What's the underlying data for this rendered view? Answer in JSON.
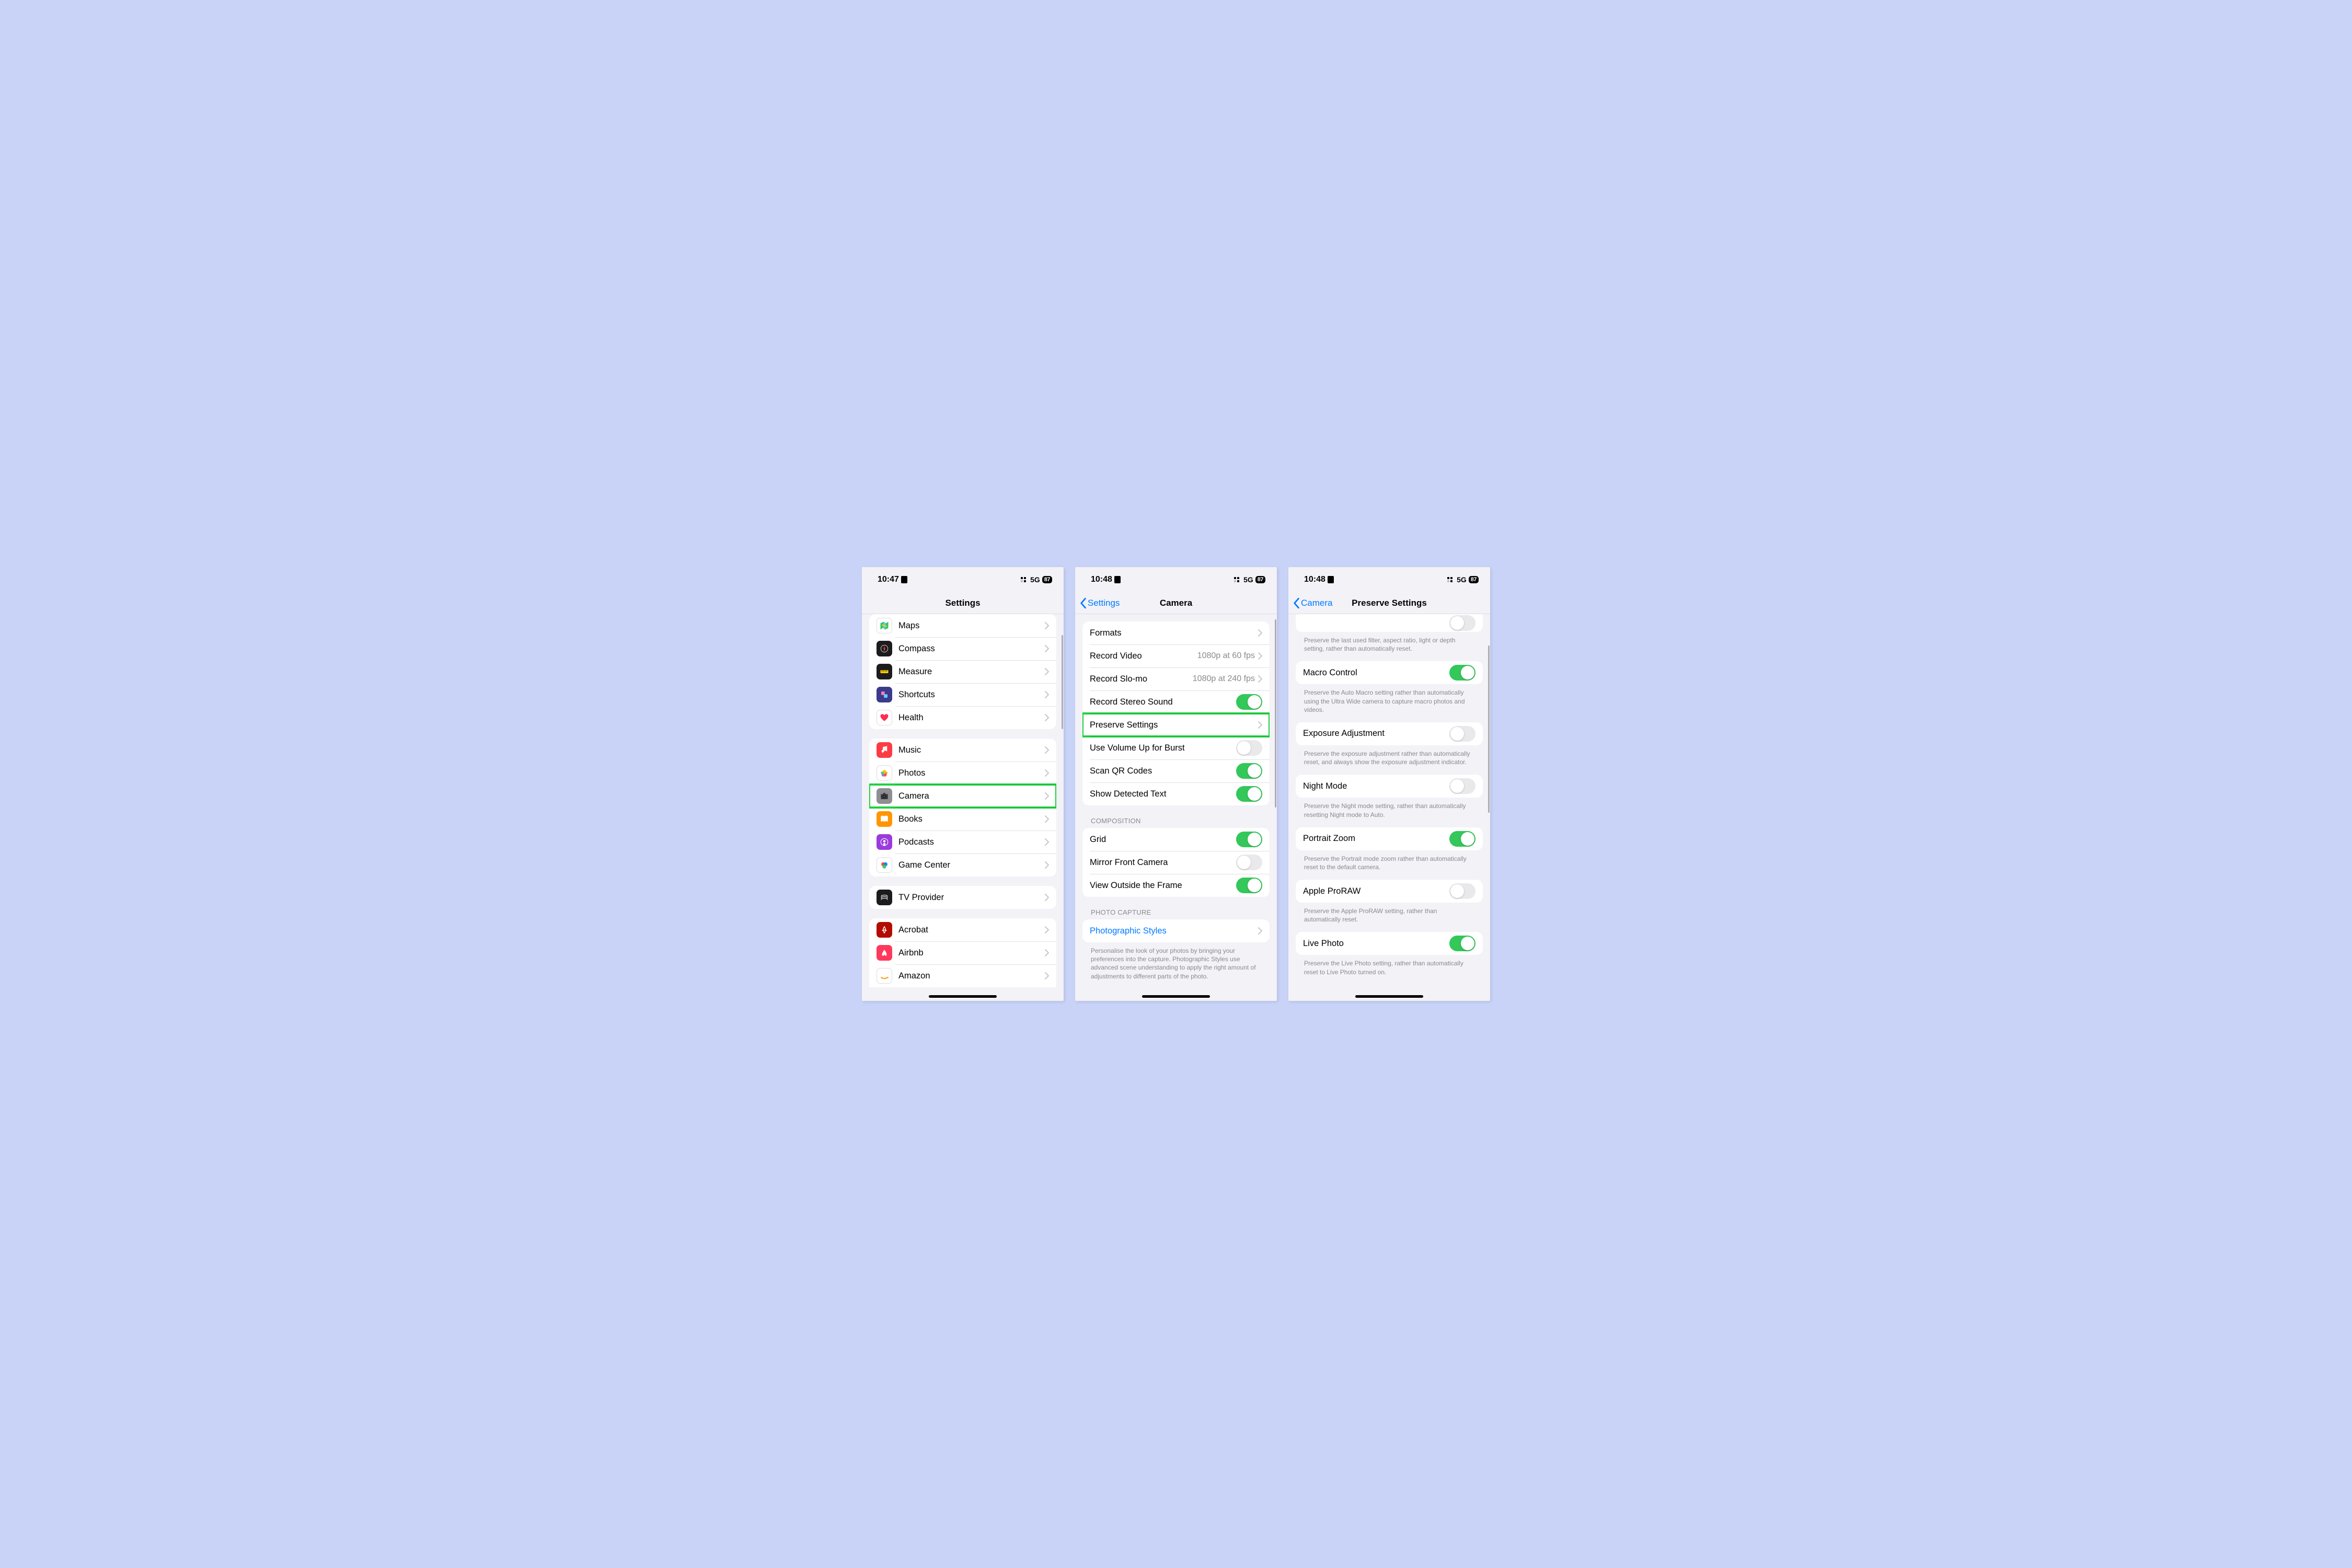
{
  "status": {
    "time1": "10:47",
    "time2": "10:48",
    "cell": "5G",
    "battery": "87"
  },
  "screen1": {
    "title": "Settings",
    "group1": [
      {
        "name": "maps",
        "label": "Maps",
        "bg": "#fff",
        "emoji": "maps"
      },
      {
        "name": "compass",
        "label": "Compass",
        "bg": "#1C1C1E",
        "emoji": "compass"
      },
      {
        "name": "measure",
        "label": "Measure",
        "bg": "#1C1C1E",
        "emoji": "measure"
      },
      {
        "name": "shortcuts",
        "label": "Shortcuts",
        "bg": "#3B3A8C",
        "emoji": "shortcuts"
      },
      {
        "name": "health",
        "label": "Health",
        "bg": "#fff",
        "emoji": "health"
      }
    ],
    "group2": [
      {
        "name": "music",
        "label": "Music",
        "bg": "#FC3C44",
        "emoji": "music"
      },
      {
        "name": "photos",
        "label": "Photos",
        "bg": "#fff",
        "emoji": "photos"
      },
      {
        "name": "camera",
        "label": "Camera",
        "bg": "#8E8E93",
        "emoji": "camera",
        "highlight": true
      },
      {
        "name": "books",
        "label": "Books",
        "bg": "#FF9500",
        "emoji": "books"
      },
      {
        "name": "podcasts",
        "label": "Podcasts",
        "bg": "#9B3BDC",
        "emoji": "podcasts"
      },
      {
        "name": "gamecenter",
        "label": "Game Center",
        "bg": "#fff",
        "emoji": "gamecenter"
      }
    ],
    "group3": [
      {
        "name": "tvprovider",
        "label": "TV Provider",
        "bg": "#1C1C1E",
        "emoji": "tvprovider"
      }
    ],
    "group4": [
      {
        "name": "acrobat",
        "label": "Acrobat",
        "bg": "#B30B00",
        "emoji": "acrobat"
      },
      {
        "name": "airbnb",
        "label": "Airbnb",
        "bg": "#FF385C",
        "emoji": "airbnb"
      },
      {
        "name": "amazon",
        "label": "Amazon",
        "bg": "#fff",
        "emoji": "amazon"
      }
    ]
  },
  "screen2": {
    "back": "Settings",
    "title": "Camera",
    "rows1": [
      {
        "name": "formats",
        "label": "Formats",
        "type": "chevron"
      },
      {
        "name": "recordvideo",
        "label": "Record Video",
        "detail": "1080p at 60 fps",
        "type": "chevron"
      },
      {
        "name": "recordslomo",
        "label": "Record Slo-mo",
        "detail": "1080p at 240 fps",
        "type": "chevron"
      },
      {
        "name": "stereosound",
        "label": "Record Stereo Sound",
        "type": "toggle",
        "on": true
      },
      {
        "name": "preservesettings",
        "label": "Preserve Settings",
        "type": "chevron",
        "highlight": true
      },
      {
        "name": "volumeburst",
        "label": "Use Volume Up for Burst",
        "type": "toggle",
        "on": false
      },
      {
        "name": "scanqr",
        "label": "Scan QR Codes",
        "type": "toggle",
        "on": true
      },
      {
        "name": "detectedtext",
        "label": "Show Detected Text",
        "type": "toggle",
        "on": true
      }
    ],
    "composition_header": "COMPOSITION",
    "rows2": [
      {
        "name": "grid",
        "label": "Grid",
        "type": "toggle",
        "on": true
      },
      {
        "name": "mirror",
        "label": "Mirror Front Camera",
        "type": "toggle",
        "on": false
      },
      {
        "name": "outsideframe",
        "label": "View Outside the Frame",
        "type": "toggle",
        "on": true
      }
    ],
    "photocapture_header": "PHOTO CAPTURE",
    "rows3": [
      {
        "name": "photostyles",
        "label": "Photographic Styles",
        "type": "chevron",
        "link": true
      }
    ],
    "footer": "Personalise the look of your photos by bringing your preferences into the capture. Photographic Styles use advanced scene understanding to apply the right amount of adjustments to different parts of the photo."
  },
  "screen3": {
    "back": "Camera",
    "title": "Preserve Settings",
    "peek_footer": "Preserve the last used filter, aspect ratio, light or depth setting, rather than automatically reset.",
    "sections": [
      {
        "name": "macro",
        "label": "Macro Control",
        "on": true,
        "footer": "Preserve the Auto Macro setting rather than automatically using the Ultra Wide camera to capture macro photos and videos."
      },
      {
        "name": "exposure",
        "label": "Exposure Adjustment",
        "on": false,
        "footer": "Preserve the exposure adjustment rather than automatically reset, and always show the exposure adjustment indicator."
      },
      {
        "name": "nightmode",
        "label": "Night Mode",
        "on": false,
        "footer": "Preserve the Night mode setting, rather than automatically resetting Night mode to Auto."
      },
      {
        "name": "portraitzoom",
        "label": "Portrait Zoom",
        "on": true,
        "footer": "Preserve the Portrait mode zoom rather than automatically reset to the default camera."
      },
      {
        "name": "proraw",
        "label": "Apple ProRAW",
        "on": false,
        "footer": "Preserve the Apple ProRAW setting, rather than automatically reset."
      },
      {
        "name": "livephoto",
        "label": "Live Photo",
        "on": true,
        "footer": "Preserve the Live Photo setting, rather than automatically reset to Live Photo turned on."
      }
    ]
  }
}
